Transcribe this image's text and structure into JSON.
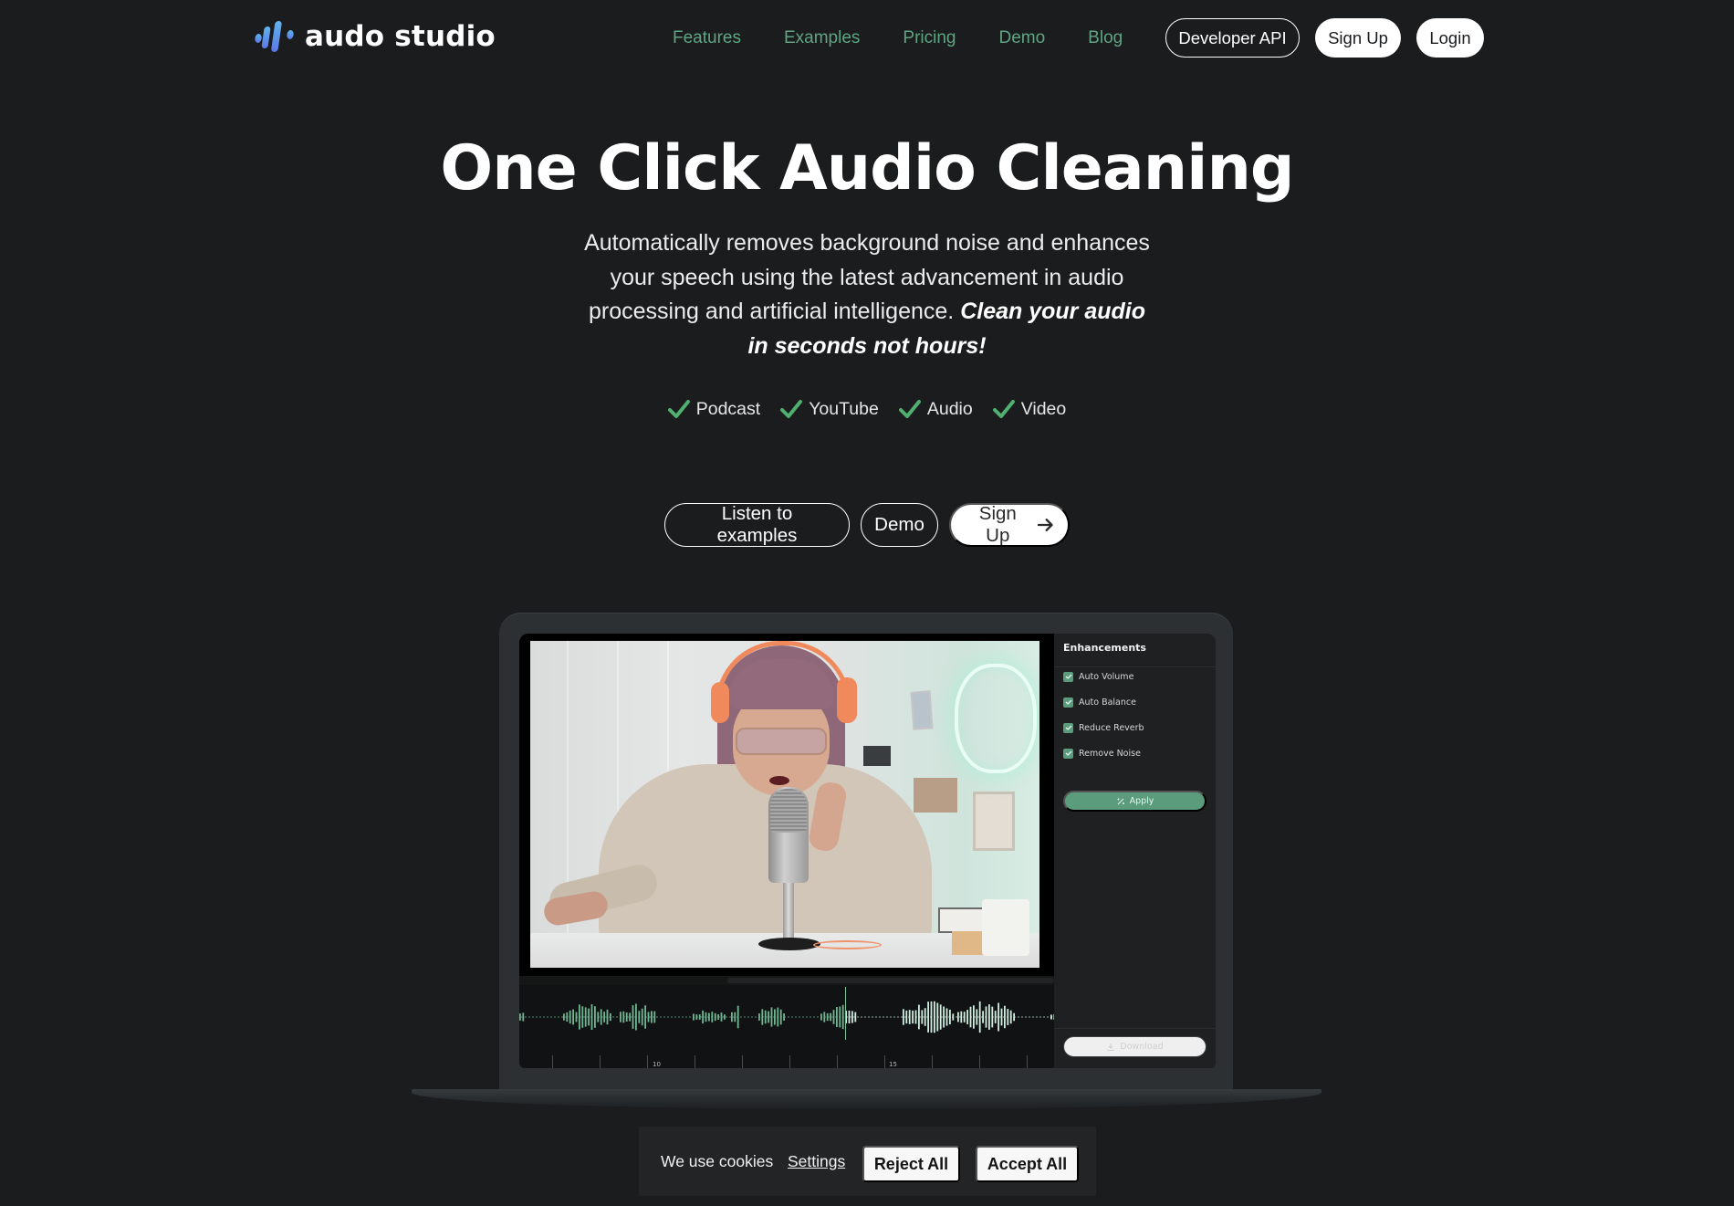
{
  "brand": {
    "name": "audo studio",
    "logo_icon": "sound-bars-logo-icon",
    "logo_gradient": [
      "#3aa0e0",
      "#6b7ff0"
    ]
  },
  "nav": {
    "links": [
      {
        "label": "Features"
      },
      {
        "label": "Examples"
      },
      {
        "label": "Pricing"
      },
      {
        "label": "Demo"
      },
      {
        "label": "Blog"
      }
    ],
    "developer_api_label": "Developer API",
    "signup_label": "Sign Up",
    "login_label": "Login",
    "link_color": "#5fa583"
  },
  "hero": {
    "title": "One Click Audio Cleaning",
    "subtitle": "Automatically removes background noise and enhances your speech using the latest advancement in audio processing and artificial intelligence.",
    "subtitle_emphasis": "Clean your audio in seconds not hours!",
    "features": [
      {
        "label": "Podcast",
        "icon": "check-icon"
      },
      {
        "label": "YouTube",
        "icon": "check-icon"
      },
      {
        "label": "Audio",
        "icon": "check-icon"
      },
      {
        "label": "Video",
        "icon": "check-icon"
      }
    ],
    "check_color": "#4fb070",
    "cta": {
      "listen_label": "Listen to examples",
      "demo_label": "Demo",
      "signup_label": "Sign Up",
      "signup_icon": "arrow-right-icon"
    }
  },
  "app_preview": {
    "panel_title": "Enhancements",
    "enhancements": [
      {
        "label": "Auto Volume",
        "checked": true
      },
      {
        "label": "Auto Balance",
        "checked": true
      },
      {
        "label": "Reduce Reverb",
        "checked": true
      },
      {
        "label": "Remove Noise",
        "checked": true
      }
    ],
    "apply_label": "Apply",
    "apply_icon": "magic-wand-icon",
    "download_label": "Download",
    "download_icon": "download-icon",
    "timeline_labels": [
      "10",
      "15"
    ],
    "accent_color": "#5a9c7c",
    "waveform_colors": {
      "played": "#6fb693",
      "unplayed": "#cfeee0"
    }
  },
  "cookie_banner": {
    "text": "We use cookies",
    "settings_label": "Settings",
    "reject_label": "Reject All",
    "accept_label": "Accept All"
  }
}
